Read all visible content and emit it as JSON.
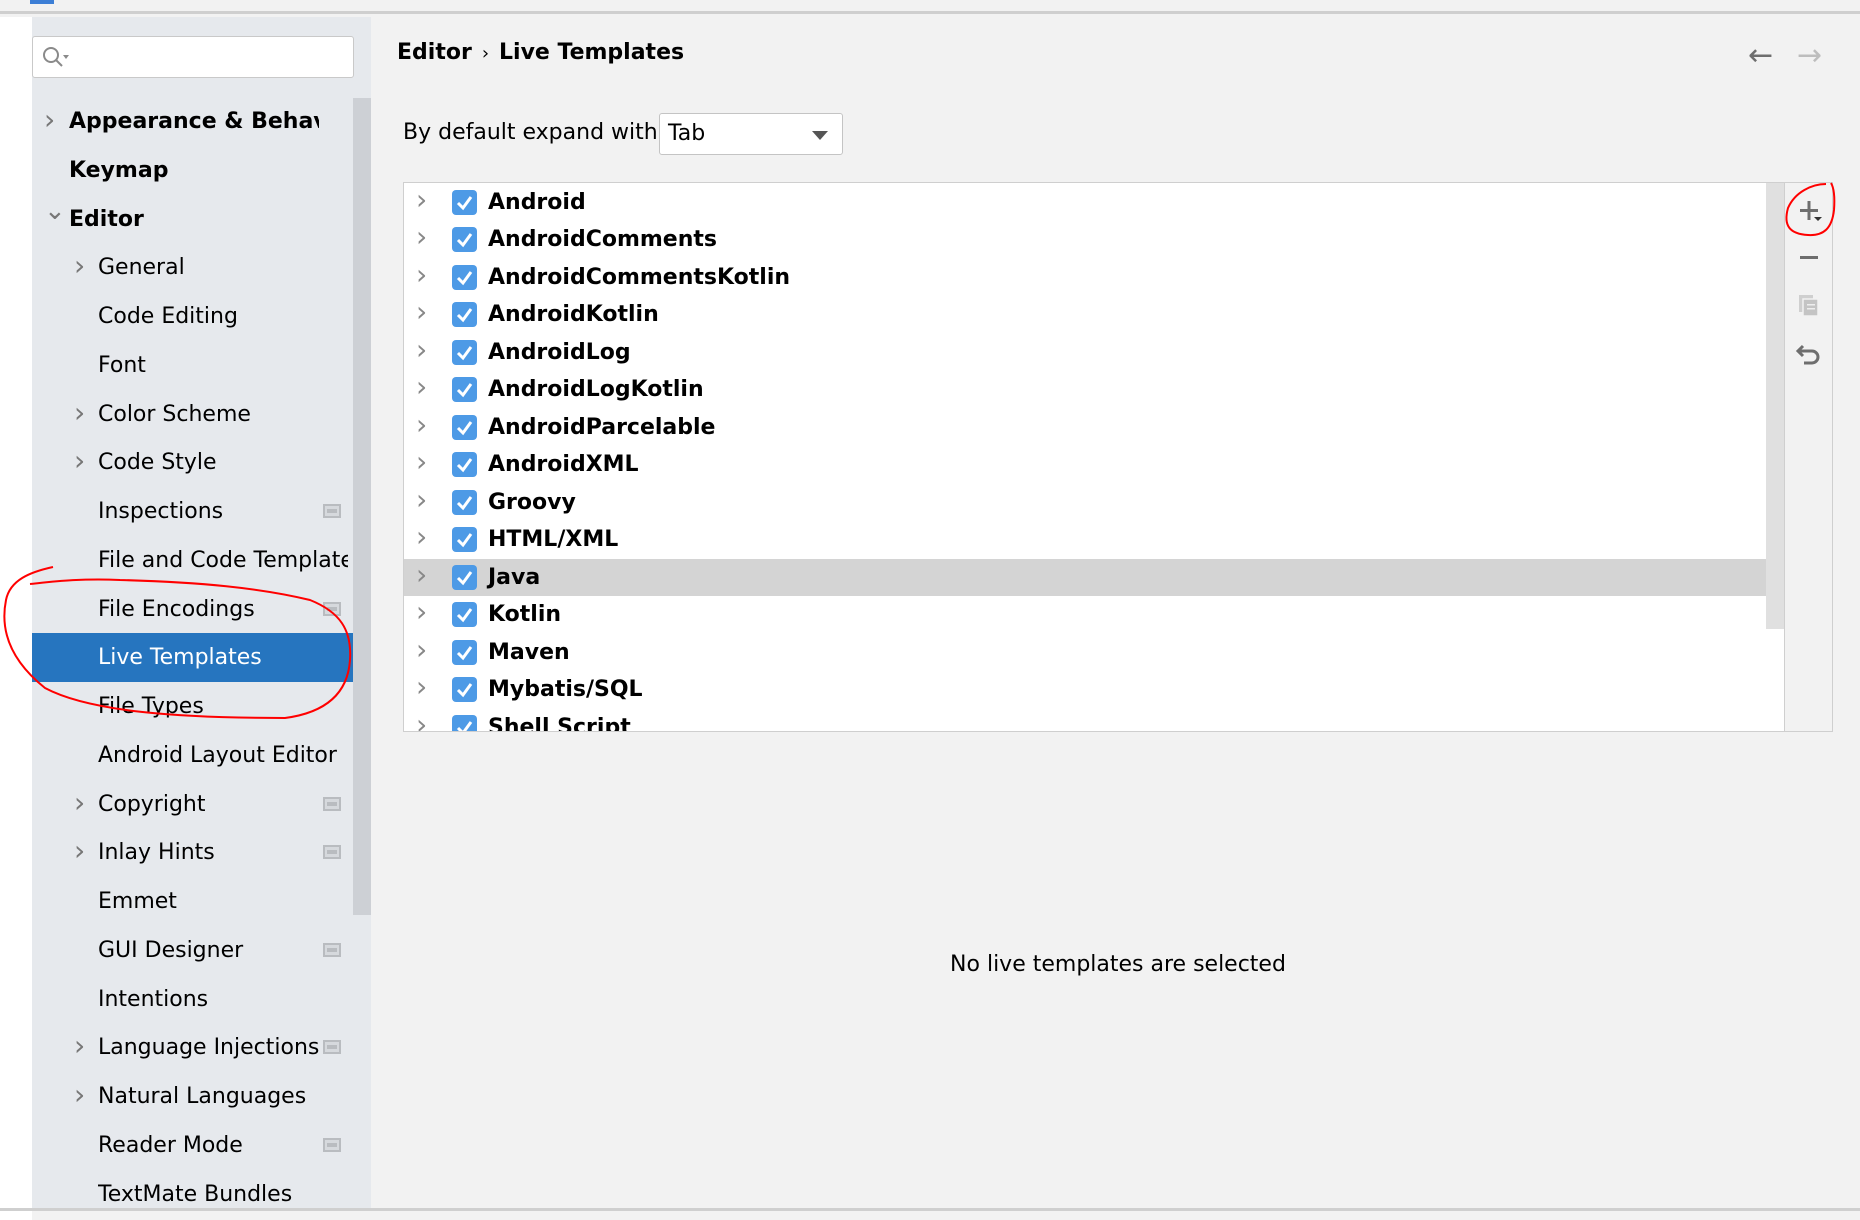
{
  "search": {
    "placeholder": ""
  },
  "sidebar": {
    "items": [
      {
        "label": "Appearance & Behavior",
        "level": 0,
        "arrow": "right"
      },
      {
        "label": "Keymap",
        "level": 0,
        "arrow": ""
      },
      {
        "label": "Editor",
        "level": 0,
        "arrow": "down"
      },
      {
        "label": "General",
        "level": 1,
        "arrow": "right"
      },
      {
        "label": "Code Editing",
        "level": 1,
        "arrow": ""
      },
      {
        "label": "Font",
        "level": 1,
        "arrow": ""
      },
      {
        "label": "Color Scheme",
        "level": 1,
        "arrow": "right"
      },
      {
        "label": "Code Style",
        "level": 1,
        "arrow": "right"
      },
      {
        "label": "Inspections",
        "level": 1,
        "arrow": "",
        "badge": true
      },
      {
        "label": "File and Code Templates",
        "level": 1,
        "arrow": ""
      },
      {
        "label": "File Encodings",
        "level": 1,
        "arrow": "",
        "badge": true
      },
      {
        "label": "Live Templates",
        "level": 1,
        "arrow": "",
        "selected": true
      },
      {
        "label": "File Types",
        "level": 1,
        "arrow": ""
      },
      {
        "label": "Android Layout Editor",
        "level": 1,
        "arrow": ""
      },
      {
        "label": "Copyright",
        "level": 1,
        "arrow": "right",
        "badge": true
      },
      {
        "label": "Inlay Hints",
        "level": 1,
        "arrow": "right",
        "badge": true
      },
      {
        "label": "Emmet",
        "level": 1,
        "arrow": ""
      },
      {
        "label": "GUI Designer",
        "level": 1,
        "arrow": "",
        "badge": true
      },
      {
        "label": "Intentions",
        "level": 1,
        "arrow": ""
      },
      {
        "label": "Language Injections",
        "level": 1,
        "arrow": "right",
        "badge": true
      },
      {
        "label": "Natural Languages",
        "level": 1,
        "arrow": "right"
      },
      {
        "label": "Reader Mode",
        "level": 1,
        "arrow": "",
        "badge": true
      },
      {
        "label": "TextMate Bundles",
        "level": 1,
        "arrow": ""
      }
    ]
  },
  "breadcrumb": {
    "parent": "Editor",
    "separator": "›",
    "current": "Live Templates"
  },
  "nav": {
    "back_icon": "arrow-left-icon",
    "forward_icon": "arrow-right-icon"
  },
  "expand": {
    "label": "By default expand with",
    "value": "Tab"
  },
  "templates": {
    "groups": [
      {
        "name": "Android",
        "checked": true
      },
      {
        "name": "AndroidComments",
        "checked": true
      },
      {
        "name": "AndroidCommentsKotlin",
        "checked": true
      },
      {
        "name": "AndroidKotlin",
        "checked": true
      },
      {
        "name": "AndroidLog",
        "checked": true
      },
      {
        "name": "AndroidLogKotlin",
        "checked": true
      },
      {
        "name": "AndroidParcelable",
        "checked": true
      },
      {
        "name": "AndroidXML",
        "checked": true
      },
      {
        "name": "Groovy",
        "checked": true
      },
      {
        "name": "HTML/XML",
        "checked": true
      },
      {
        "name": "Java",
        "checked": true,
        "selected": true
      },
      {
        "name": "Kotlin",
        "checked": true
      },
      {
        "name": "Maven",
        "checked": true
      },
      {
        "name": "Mybatis/SQL",
        "checked": true
      },
      {
        "name": "Shell Script",
        "checked": true
      }
    ]
  },
  "toolbar": {
    "icons": [
      "add-icon",
      "remove-icon",
      "copy-icon",
      "restore-icon"
    ]
  },
  "empty_state": "No live templates are selected",
  "colors": {
    "selection": "#2675bf",
    "checkbox": "#4d9ae6",
    "annotation": "#ff0000",
    "row_highlight": "#d4d4d4"
  }
}
